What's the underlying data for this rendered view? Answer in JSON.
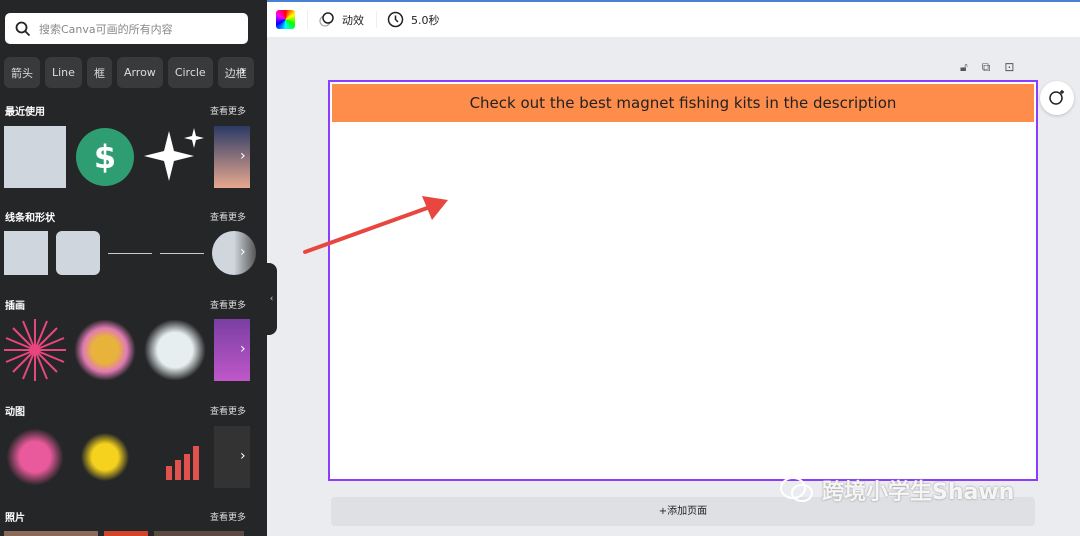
{
  "sidebar": {
    "search_placeholder": "搜索Canva可画的所有内容",
    "chips": [
      "箭头",
      "Line",
      "框",
      "Arrow",
      "Circle",
      "边框"
    ],
    "sections": [
      {
        "title": "最近使用",
        "more": "查看更多"
      },
      {
        "title": "线条和形状",
        "more": "查看更多"
      },
      {
        "title": "插画",
        "more": "查看更多"
      },
      {
        "title": "动图",
        "more": "查看更多"
      },
      {
        "title": "照片",
        "more": "查看更多"
      }
    ]
  },
  "toolbar": {
    "animate_label": "动效",
    "duration_label": "5.0秒"
  },
  "canvas": {
    "banner_text": "Check out the best magnet fishing kits in the description",
    "banner_color": "#fe8c4b",
    "selection_color": "#8b3dff",
    "arrow_color": "#e8473f"
  },
  "add_page_label": "+添加页面",
  "watermark": "跨境小学生Shawn"
}
